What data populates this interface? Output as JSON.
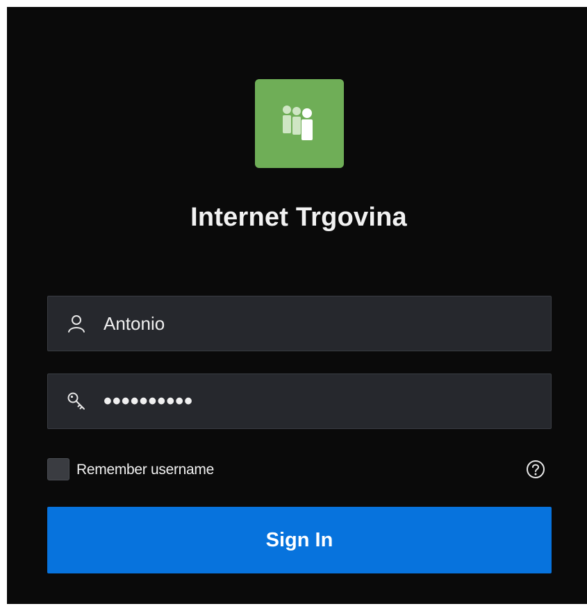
{
  "app": {
    "title": "Internet Trgovina",
    "logo_icon": "people-group-icon",
    "logo_color": "#6fae57"
  },
  "login": {
    "username": {
      "icon": "user-icon",
      "value": "Antonio"
    },
    "password": {
      "icon": "key-icon",
      "masked_value": "••••••••••"
    },
    "remember": {
      "label": "Remember username",
      "checked": false
    },
    "help_icon": "help-circle-icon",
    "submit_label": "Sign In"
  },
  "colors": {
    "background": "#0a0a0a",
    "field_bg": "#26282d",
    "accent": "#0773dd"
  }
}
